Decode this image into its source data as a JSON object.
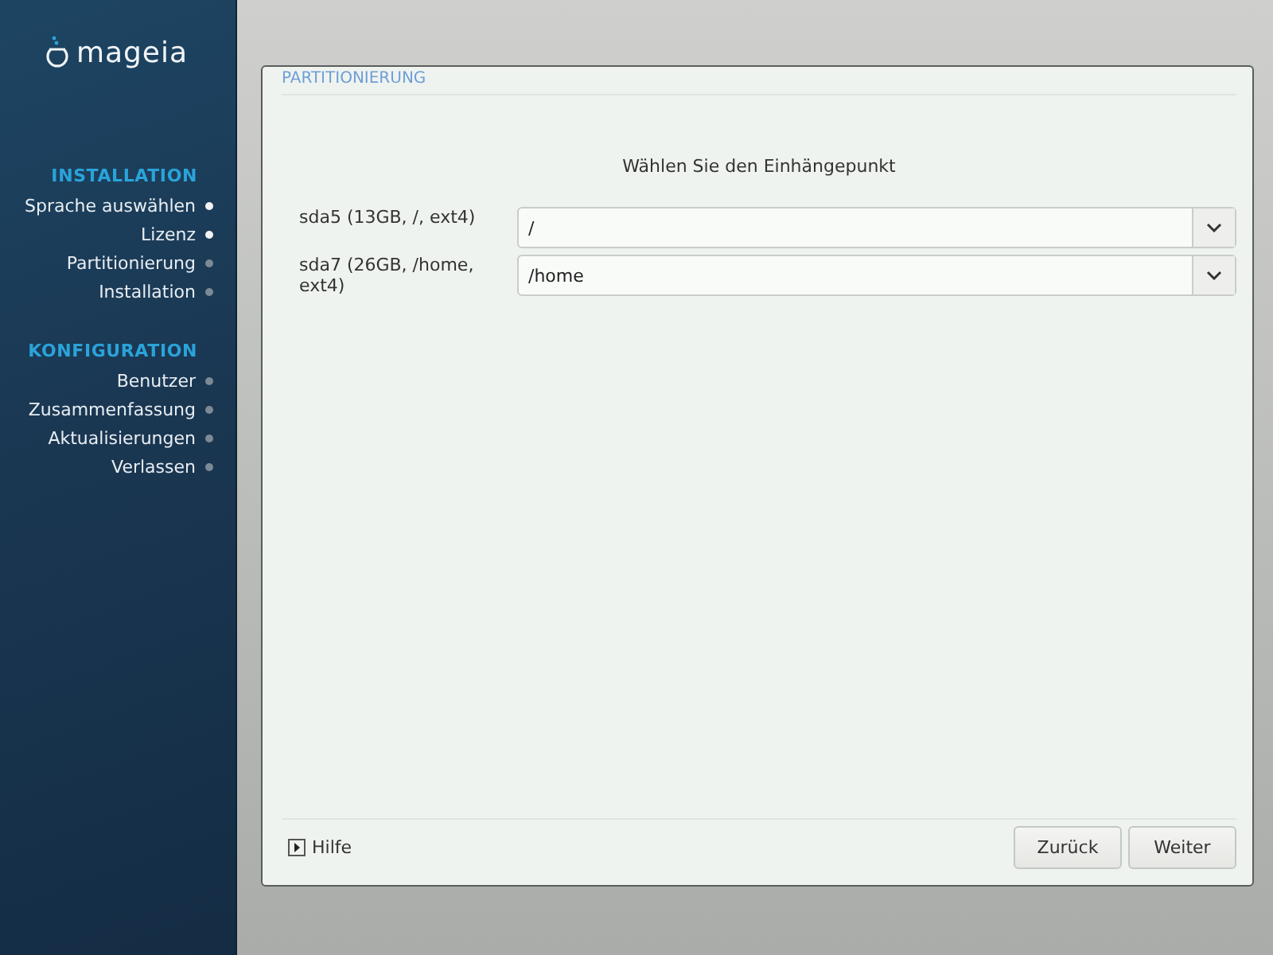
{
  "logo": {
    "text": "mageia"
  },
  "sidebar": {
    "sections": [
      {
        "title": "INSTALLATION",
        "steps": [
          {
            "label": "Sprache auswählen",
            "done": true
          },
          {
            "label": "Lizenz",
            "done": true
          },
          {
            "label": "Partitionierung",
            "done": false
          },
          {
            "label": "Installation",
            "done": false
          }
        ]
      },
      {
        "title": "KONFIGURATION",
        "steps": [
          {
            "label": "Benutzer",
            "done": false
          },
          {
            "label": "Zusammenfassung",
            "done": false
          },
          {
            "label": "Aktualisierungen",
            "done": false
          },
          {
            "label": "Verlassen",
            "done": false
          }
        ]
      }
    ]
  },
  "dialog": {
    "title": "PARTITIONIERUNG",
    "prompt": "Wählen Sie den Einhängepunkt",
    "rows": [
      {
        "label": "sda5 (13GB, /, ext4)",
        "value": "/"
      },
      {
        "label": "sda7 (26GB, /home, ext4)",
        "value": "/home"
      }
    ],
    "help": {
      "label": "Hilfe",
      "expanded": false
    },
    "buttons": [
      "Zurück",
      "Weiter"
    ]
  }
}
